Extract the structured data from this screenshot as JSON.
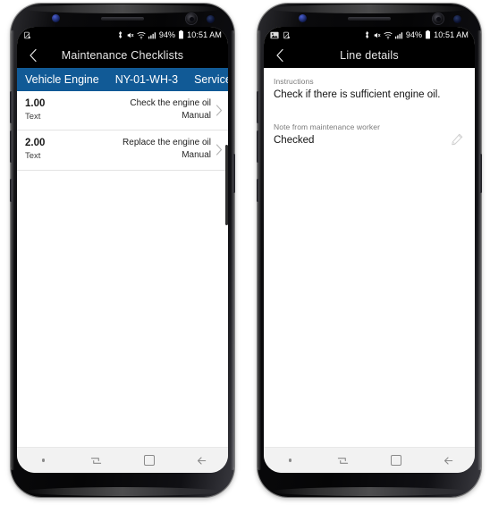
{
  "phones": [
    {
      "id": "left",
      "name": "maintenance-checklists-phone",
      "statusbar": {
        "left_icons": [
          "no-sim-icon"
        ],
        "right_icons": [
          "bluetooth-icon",
          "mute-icon",
          "wifi-icon",
          "signal-icon",
          "battery-icon"
        ],
        "battery_percent": "94%",
        "time": "10:51 AM"
      },
      "titlebar": {
        "back_label": "back-chevron",
        "title": "Maintenance Checklists"
      },
      "context_bar": {
        "items": [
          "Vehicle Engine",
          "NY-01-WH-3",
          "Service"
        ],
        "color": "#115a96"
      },
      "list": [
        {
          "number": "1.00",
          "subtype": "Text",
          "title": "Check the engine oil",
          "meta": "Manual"
        },
        {
          "number": "2.00",
          "subtype": "Text",
          "title": "Replace the engine oil",
          "meta": "Manual"
        }
      ],
      "navbar": {
        "items": [
          "nav-dot",
          "recent-apps-icon",
          "home-icon",
          "back-icon"
        ]
      }
    },
    {
      "id": "right",
      "name": "line-details-phone",
      "statusbar": {
        "left_icons": [
          "image-icon",
          "no-sim-icon"
        ],
        "right_icons": [
          "bluetooth-icon",
          "mute-icon",
          "wifi-icon",
          "signal-icon",
          "battery-icon"
        ],
        "battery_percent": "94%",
        "time": "10:51 AM"
      },
      "titlebar": {
        "back_label": "back-chevron",
        "title": "Line details"
      },
      "details": {
        "instructions_label": "Instructions",
        "instructions_value": "Check if there is sufficient engine oil.",
        "note_label": "Note from maintenance worker",
        "note_value": "Checked",
        "edit_icon": "pencil-icon"
      },
      "navbar": {
        "items": [
          "nav-dot",
          "recent-apps-icon",
          "home-icon",
          "back-icon"
        ]
      }
    }
  ]
}
